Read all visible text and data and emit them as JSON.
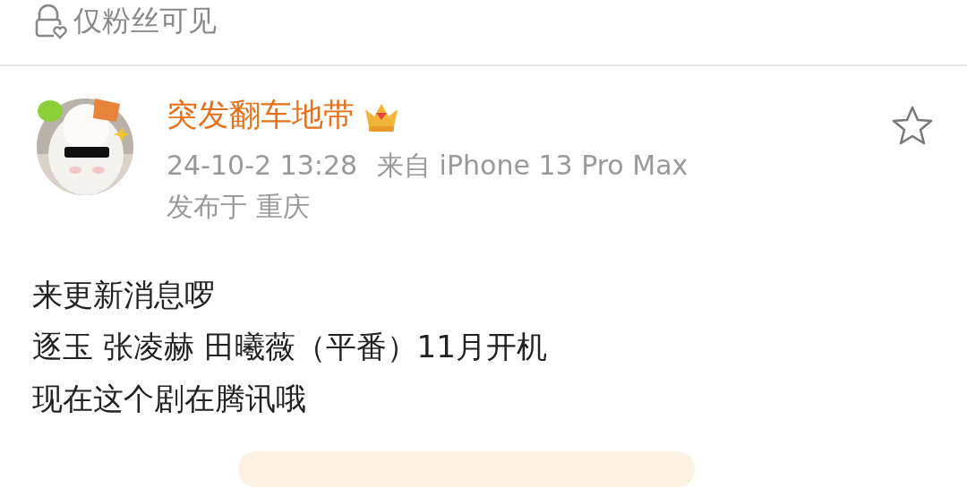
{
  "visibility": {
    "label": "仅粉丝可见"
  },
  "post": {
    "author": "突发翻车地带",
    "starred": false,
    "time": "24-10-2 13:28",
    "source": "来自 iPhone 13 Pro Max",
    "location": "发布于 重庆",
    "lines": [
      "来更新消息啰",
      "逐玉 张凌赫 田曦薇（平番）11月开机",
      "现在这个剧在腾讯哦"
    ]
  }
}
